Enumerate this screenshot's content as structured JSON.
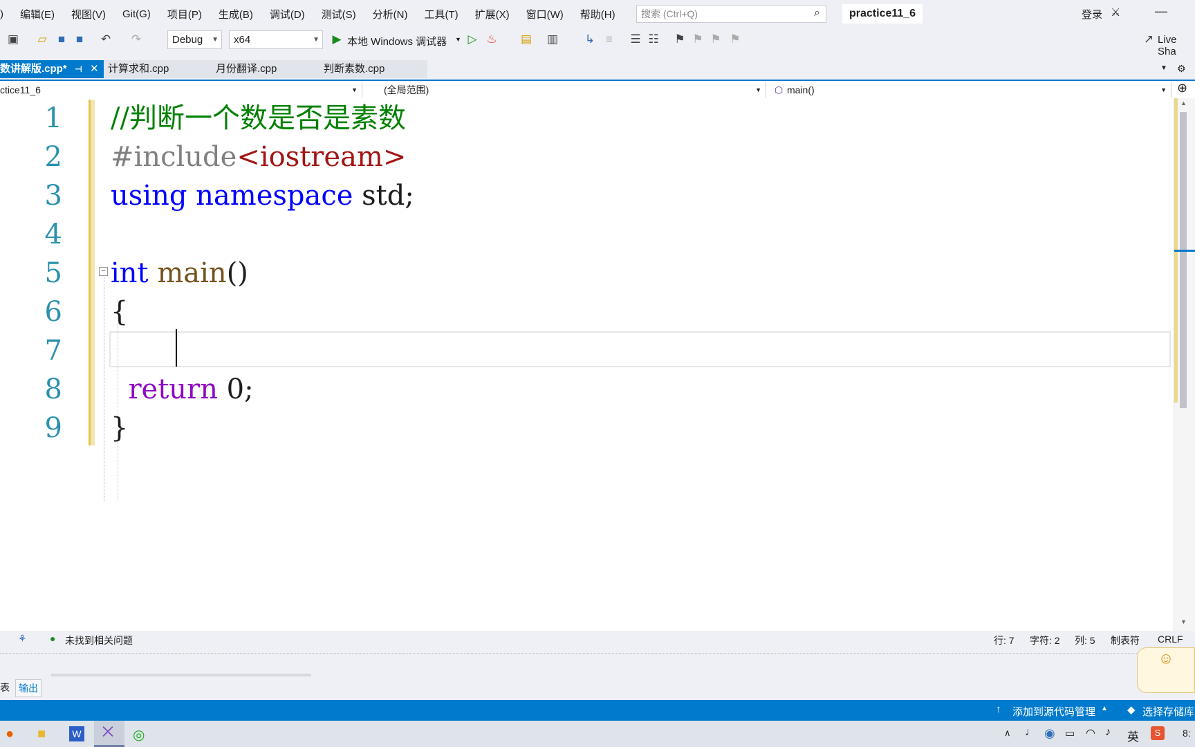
{
  "menu": {
    "items": [
      ")",
      "编辑(E)",
      "视图(V)",
      "Git(G)",
      "项目(P)",
      "生成(B)",
      "调试(D)",
      "测试(S)",
      "分析(N)",
      "工具(T)",
      "扩展(X)",
      "窗口(W)",
      "帮助(H)"
    ],
    "search_placeholder": "搜索 (Ctrl+Q)",
    "project_title": "practice11_6",
    "login": "登录"
  },
  "toolbar": {
    "config": "Debug",
    "platform": "x64",
    "debugger": "本地 Windows 调试器",
    "live_share": "Live Sha"
  },
  "tabs": [
    {
      "label": "数讲解版.cpp*",
      "active": true
    },
    {
      "label": "计算求和.cpp",
      "active": false
    },
    {
      "label": "月份翻译.cpp",
      "active": false
    },
    {
      "label": "判断素数.cpp",
      "active": false
    }
  ],
  "navbar": {
    "project": "ctice11_6",
    "scope": "(全局范围)",
    "function": "main()"
  },
  "code": {
    "line_numbers": [
      "1",
      "2",
      "3",
      "4",
      "5",
      "6",
      "7",
      "8",
      "9"
    ],
    "line1": "//判断一个数是否是素数",
    "line2_directive": "#include",
    "line2_header": "<iostream>",
    "line3_kw1": "using",
    "line3_kw2": "namespace",
    "line3_rest": " std;",
    "line5_kw": "int",
    "line5_fn": "main",
    "line5_rest": "()",
    "line6": "{",
    "line8_kw": "return",
    "line8_rest": " 0;",
    "line9": "}"
  },
  "status": {
    "issues": "未找到相关问题",
    "line": "行: 7",
    "char": "字符: 2",
    "col": "列: 5",
    "tabs": "制表符",
    "eol": "CRLF"
  },
  "panel": {
    "tab1": "表",
    "tab2": "输出"
  },
  "bottombar": {
    "add_source": "添加到源代码管理",
    "select_repo": "选择存储库"
  },
  "tray": {
    "ime": "英",
    "clock": "8:"
  },
  "colors": {
    "accent": "#007acc",
    "comment": "#008000",
    "keyword": "#0000ff",
    "preprocessor": "#808080",
    "string": "#a31515",
    "control": "#8f08c4",
    "function": "#74531f",
    "line_number": "#2b91af"
  }
}
